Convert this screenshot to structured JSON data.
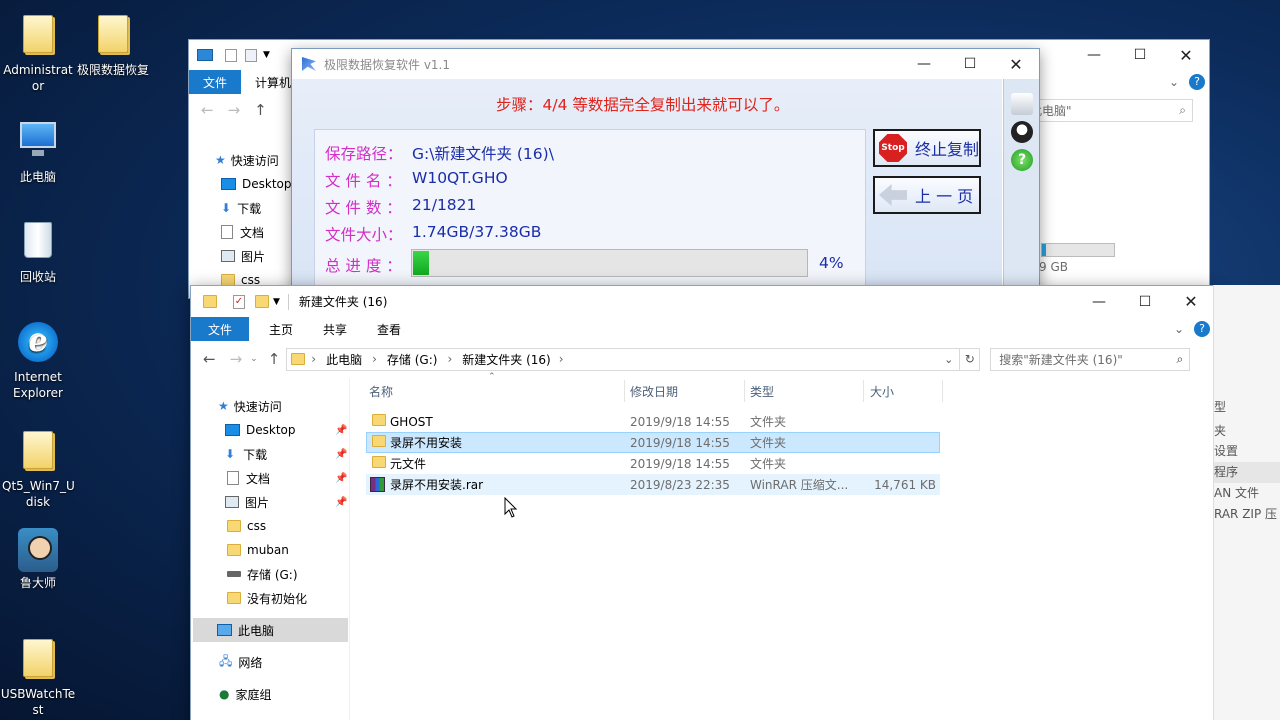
{
  "desktop": {
    "icons": [
      {
        "label": "Administrator",
        "icon": "user-folder-icon"
      },
      {
        "label": "极限数据恢复",
        "icon": "folder-icon"
      },
      {
        "label": "此电脑",
        "icon": "computer-icon"
      },
      {
        "label": "回收站",
        "icon": "recycle-bin-icon"
      },
      {
        "label": "Internet Explorer",
        "icon": "ie-icon"
      },
      {
        "label": "Qt5_Win7_U disk",
        "icon": "folder-icon"
      },
      {
        "label": "鲁大师",
        "icon": "ludashi-icon"
      },
      {
        "label": "USBWatchTest",
        "icon": "folder-icon"
      }
    ]
  },
  "back_explorer": {
    "tab_file": "文件",
    "tab_computer": "计算机",
    "search_partial": "此电脑\"",
    "nav": [
      "快速访问",
      "Desktop",
      "下载",
      "文档",
      "图片",
      "css"
    ],
    "drive_partial": "9 GB",
    "right_partial": [
      "型",
      "夹",
      "设置",
      "程序",
      "AN 文件",
      "RAR ZIP 压"
    ]
  },
  "recovery": {
    "title": "极限数据恢复软件 v1.1",
    "step": "步骤：4/4 等数据完全复制出来就可以了。",
    "rows": [
      {
        "label": "保存路径：",
        "value": "G:\\新建文件夹 (16)\\"
      },
      {
        "label": "文 件 名 ：",
        "value": "W10QT.GHO"
      },
      {
        "label": "文 件 数 ：",
        "value": "21/1821"
      },
      {
        "label": "文件大小：",
        "value": "1.74GB/37.38GB"
      }
    ],
    "progress_label": "总 进 度 ：",
    "progress_percent": "4%",
    "progress_value": 4,
    "stop_button": "终止复制",
    "stop_icon_text": "Stop",
    "prev_button": "上 一 页"
  },
  "explorer": {
    "title": "新建文件夹 (16)",
    "tabs": [
      "文件",
      "主页",
      "共享",
      "查看"
    ],
    "breadcrumb": [
      "此电脑",
      "存储 (G:)",
      "新建文件夹 (16)"
    ],
    "search_placeholder": "搜索\"新建文件夹 (16)\"",
    "columns": [
      "名称",
      "修改日期",
      "类型",
      "大小"
    ],
    "files": [
      {
        "name": "GHOST",
        "date": "2019/9/18 14:55",
        "type": "文件夹",
        "size": ""
      },
      {
        "name": "录屏不用安装",
        "date": "2019/9/18 14:55",
        "type": "文件夹",
        "size": ""
      },
      {
        "name": "元文件",
        "date": "2019/9/18 14:55",
        "type": "文件夹",
        "size": ""
      },
      {
        "name": "录屏不用安装.rar",
        "date": "2019/8/23 22:35",
        "type": "WinRAR 压缩文...",
        "size": "14,761 KB"
      }
    ],
    "nav": {
      "quick_access": "快速访问",
      "items": [
        "Desktop",
        "下载",
        "文档",
        "图片",
        "css",
        "muban",
        "存储 (G:)",
        "没有初始化"
      ],
      "this_pc": "此电脑",
      "network": "网络",
      "homegroup": "家庭组"
    }
  },
  "colors": {
    "accent": "#1979ca",
    "selection": "#cce8ff",
    "progress": "#10a91f",
    "step_text": "#e0231b",
    "label": "#d52dc7",
    "value": "#1b2ea8"
  }
}
